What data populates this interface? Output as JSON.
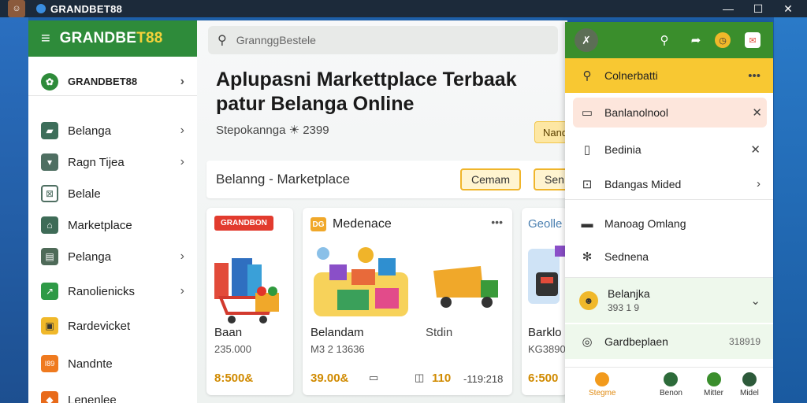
{
  "window": {
    "title": "GRANDBET88",
    "minimize": "—",
    "maximize": "☐",
    "close": "✕"
  },
  "sidebar": {
    "brand_part1": "GRANDBE",
    "brand_part2": "T88",
    "brand_row_label": "GRANDBET88",
    "items": [
      {
        "label": "Belanga",
        "icon": "store-icon",
        "color": "#3d6e5a"
      },
      {
        "label": "Ragn Tijea",
        "icon": "box-icon",
        "color": "#4f6f62"
      },
      {
        "label": "Belale",
        "icon": "grid-icon",
        "color": "#ffffff"
      },
      {
        "label": "Marketplace",
        "icon": "shop-icon",
        "color": "#3e6b57"
      },
      {
        "label": "Pelanga",
        "icon": "cart-icon",
        "color": "#4e6a58"
      },
      {
        "label": "Ranolienicks",
        "icon": "chart-icon",
        "color": "#2e9a46"
      },
      {
        "label": "Rardevicket",
        "icon": "ticket-icon",
        "color": "#f0b82a"
      },
      {
        "label": "Nandnte",
        "icon": "badge-icon",
        "color": "#ef7a1f"
      },
      {
        "label": "Lenenlee",
        "icon": "gift-icon",
        "color": "#e86a1a"
      }
    ]
  },
  "main": {
    "search_placeholder": "GrannggBestele",
    "hero_title": "Aplupasni Markettplace Terbaak patur Belanga Online",
    "hero_sub": "Stepokanng⁠a ☀ 2399",
    "hero_btn": "Nand",
    "category_label": "Belanng - Marketplace",
    "btn_primary": "Cemam",
    "btn_secondary": "Sen",
    "cards": [
      {
        "badge": "GRANDBON",
        "name": "Baan",
        "sub": "235.000",
        "price": "8:500&"
      },
      {
        "header": "Medenace",
        "name": "Belandam",
        "sub": "M3 2 13636",
        "price": "39.00&",
        "extra_name": "Stdin",
        "extra_count": "110",
        "extra_price": "-119:218"
      },
      {
        "header": "Geolle",
        "name": "Barklo",
        "sub": "KG3890",
        "price": "6:500"
      }
    ]
  },
  "panel": {
    "avatar": "✗",
    "rows": [
      {
        "label": "Colnerbatti",
        "right": "•••",
        "icon": "search-icon"
      },
      {
        "label": "Banlanolnool",
        "right": "✕",
        "icon": "tag-icon"
      },
      {
        "label": "Bedinia",
        "right": "✕",
        "icon": "book-icon"
      },
      {
        "label": "Bdangas Mided",
        "right": "›",
        "icon": "box-icon"
      },
      {
        "label": "Manoag Omlang",
        "right": "",
        "icon": "card-icon"
      },
      {
        "label": "Sednena",
        "right": "",
        "icon": "settings-icon"
      },
      {
        "label": "Belanjka",
        "sub": "393 1 9",
        "right": "⌄",
        "icon": "user-icon"
      },
      {
        "label": "Gardbeplaen",
        "right": "318919",
        "icon": "circle-icon"
      }
    ],
    "footer": [
      {
        "label": "Stegme",
        "color": "#f29a1c"
      },
      {
        "label": "Benon",
        "color": "#2d6b3a"
      },
      {
        "label": "Mitter",
        "color": "#3a8e2c"
      },
      {
        "label": "Midel",
        "color": "#2d5a3a"
      }
    ]
  }
}
